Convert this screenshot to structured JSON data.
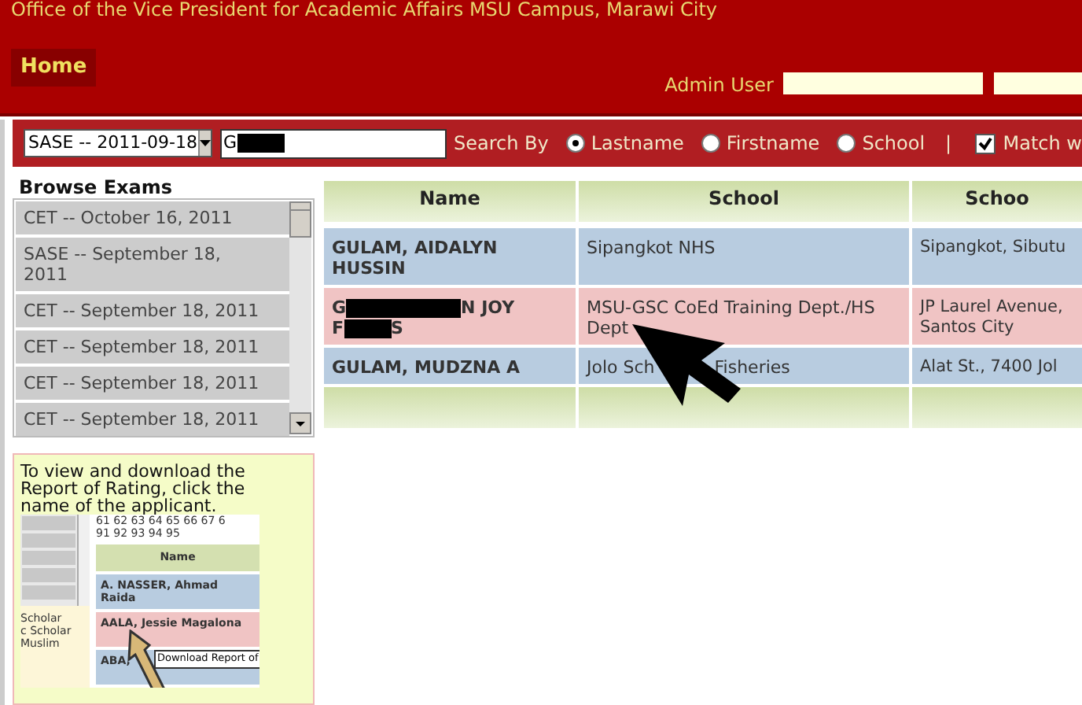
{
  "header": {
    "title": "Office of the Vice President for Academic Affairs MSU Campus, Marawi City",
    "nav": [
      {
        "label": "Home",
        "selected": true
      }
    ],
    "user": "Admin User"
  },
  "search": {
    "exam": "SASE -- 2011-09-18",
    "query_parts": [
      {
        "kind": "text",
        "text": "G"
      },
      {
        "kind": "redacted-narrow"
      }
    ],
    "search_by_label": "Search By",
    "options": [
      {
        "label": "Lastname",
        "selected": true
      },
      {
        "label": "Firstname",
        "selected": false
      },
      {
        "label": "School",
        "selected": false
      }
    ],
    "separator": "|",
    "match": {
      "label": "Match w",
      "checked": true
    }
  },
  "sidebar": {
    "title": "Browse Exams",
    "exams": [
      "CET -- October 16, 2011",
      "SASE -- September 18, 2011",
      "CET -- September 18, 2011",
      "CET -- September 18, 2011",
      "CET -- September 18, 2011",
      "CET -- September 18, 2011"
    ]
  },
  "help": {
    "text": "To view and download the Report of Rating, click the name of the applicant.",
    "example": {
      "numbers": [
        "61 62 63 64 65 66 67 6",
        "91 92 93 94 95"
      ],
      "column": "Name",
      "rows": [
        "A. NASSER, Ahmad Raida",
        "AALA, Jessie Magalona",
        "ABA,"
      ],
      "tooltip": "Download Report of",
      "side_labels": [
        "Scholar",
        "c Scholar",
        "Muslim"
      ]
    }
  },
  "table": {
    "columns": [
      "Name",
      "School",
      "Schoo"
    ],
    "rows": [
      {
        "name": [
          {
            "kind": "text",
            "text": "GULAM, AIDALYN HUSSIN"
          }
        ],
        "school": [
          {
            "kind": "text",
            "text": "Sipangkot NHS"
          }
        ],
        "column_3": "Sipangkot, Sibutu"
      },
      {
        "name": [
          {
            "kind": "text",
            "text": "G"
          },
          {
            "kind": "redacted-wide"
          },
          {
            "kind": "text",
            "text": "N JOY"
          },
          {
            "kind": "break"
          },
          {
            "kind": "text",
            "text": "F"
          },
          {
            "kind": "redacted-narrow"
          },
          {
            "kind": "text",
            "text": "S"
          }
        ],
        "school": [
          {
            "kind": "text",
            "text": "MSU-GSC CoEd Training Dept./HS Dept"
          }
        ],
        "column_3": "JP Laurel Avenue, Santos City"
      },
      {
        "name": [
          {
            "kind": "text",
            "text": "GULAM, MUDZNA A"
          }
        ],
        "school": [
          {
            "kind": "text",
            "text": "Jolo Sch"
          },
          {
            "kind": "covered"
          },
          {
            "kind": "text",
            "text": "Fisheries"
          }
        ],
        "column_3": "Alat St., 7400 Jol"
      }
    ]
  }
}
